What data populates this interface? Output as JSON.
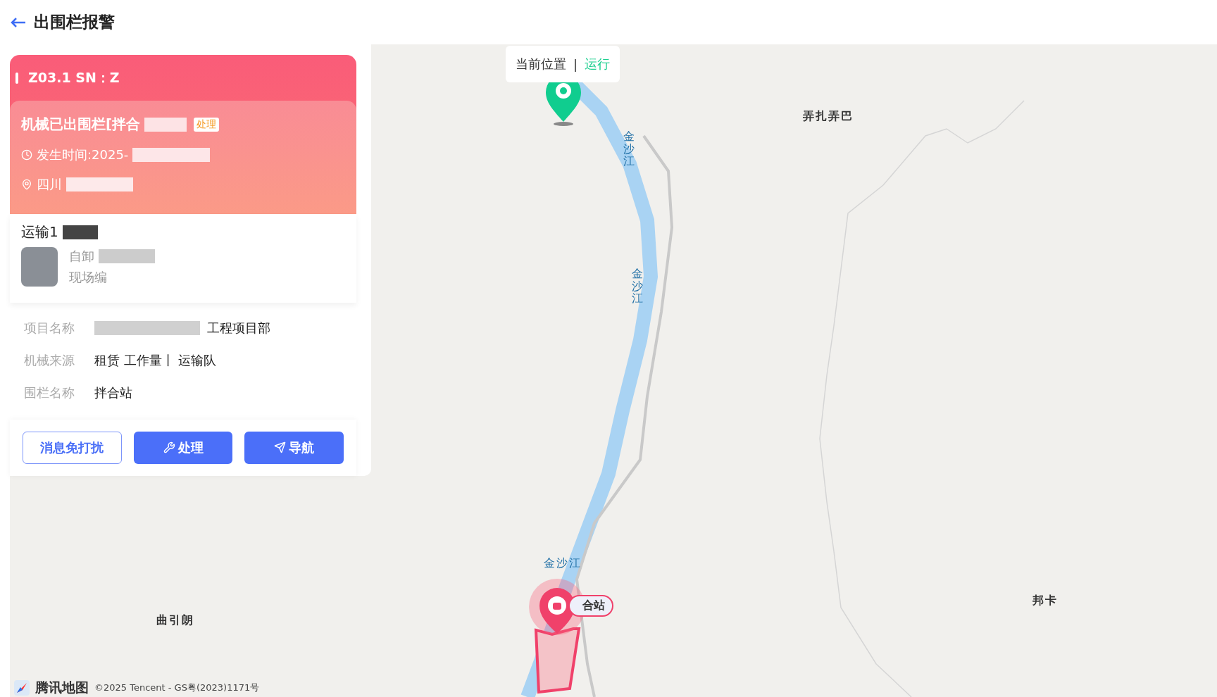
{
  "header": {
    "title": "出围栏报警"
  },
  "alarm_card": {
    "device": "Z03.1  SN：Z",
    "message": "机械已出围栏[拌合",
    "status_badge": "处理",
    "time": "发生时间:2025-",
    "location": "四川"
  },
  "vehicle": {
    "name": "运输1",
    "type": "自卸",
    "site_no": "现场编"
  },
  "info_rows": [
    {
      "label": "项目名称",
      "value": "工程项目部"
    },
    {
      "label": "机械来源",
      "value": "租赁 工作量丨 运输队"
    },
    {
      "label": "围栏名称",
      "value": "拌合站"
    }
  ],
  "buttons": [
    {
      "label": "消息免打扰",
      "kind": "outline"
    },
    {
      "label": "处理",
      "kind": "process"
    },
    {
      "label": "导航",
      "kind": "navigate"
    }
  ],
  "map": {
    "popup": {
      "label": "当前位置",
      "separator": "|",
      "status": "运行"
    },
    "places": [
      {
        "name": "弄扎弄巴",
        "kind": "place"
      },
      {
        "name": "金沙江",
        "kind": "river-vertical"
      },
      {
        "name": "金沙江",
        "kind": "river-vertical"
      },
      {
        "name": "金沙江",
        "kind": "river"
      },
      {
        "name": "曲引朗",
        "kind": "place"
      },
      {
        "name": "邦卡",
        "kind": "place"
      }
    ],
    "fence_label": "合站",
    "logo": "腾讯地图",
    "copyright": "©2025 Tencent - GS粤(2023)1171号"
  }
}
